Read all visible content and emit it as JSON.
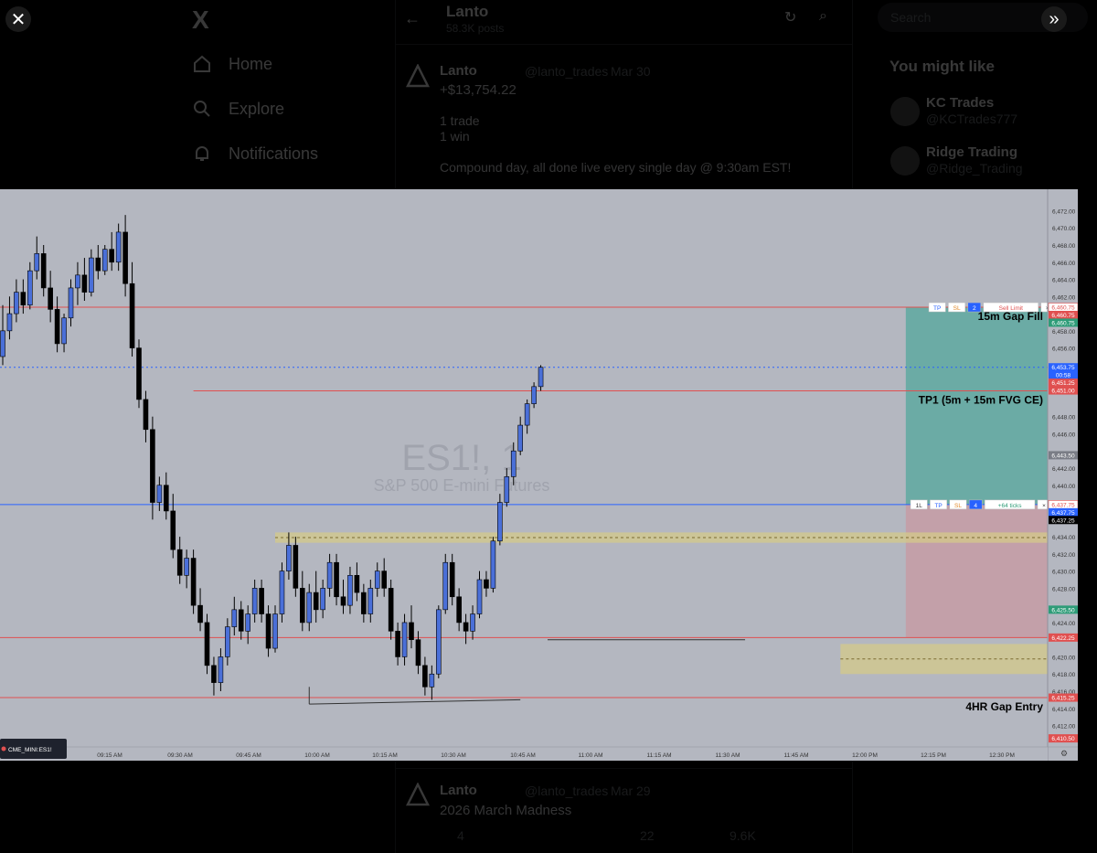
{
  "viewer": {
    "close_icon": "close-icon",
    "expand_icon": "expand-icon"
  },
  "sidebar": {
    "logo": "X",
    "items": [
      {
        "label": "Home",
        "icon": "home-icon"
      },
      {
        "label": "Explore",
        "icon": "search-icon"
      },
      {
        "label": "Notifications",
        "icon": "bell-icon"
      }
    ]
  },
  "header": {
    "author": "Lanto",
    "subtitle": "58.3K posts"
  },
  "post": {
    "name": "Lanto",
    "handle": "@lanto_trades",
    "date": "Mar 30",
    "amount": "+$13,754.22",
    "line1": "1 trade",
    "line2": "1 win",
    "body": "Compound day, all done live every single day @ 9:30am EST!"
  },
  "post2": {
    "name": "Lanto",
    "handle": "@lanto_trades",
    "date": "Mar 29",
    "body": "2026 March Madness",
    "stats": [
      "4",
      "",
      "22",
      "9.6K",
      "",
      ""
    ]
  },
  "right_panel": {
    "search_placeholder": "Search",
    "you_might_like": "You might like",
    "suggestions": [
      {
        "name": "KC Trades",
        "handle": "@KCTrades777"
      },
      {
        "name": "Ridge Trading",
        "handle": "@Ridge_Trading"
      }
    ]
  },
  "chart_data": {
    "type": "candlestick",
    "symbol": "ES1!, 1",
    "description": "S&P 500 E-mini Futures",
    "symbol_tag": "CME_MINI:ES1!",
    "colors": {
      "up": "#4a6fd8",
      "down": "#000000",
      "background": "#b4b7c0",
      "profit_zone": "#5ea9a0",
      "loss_zone": "#c59ca5",
      "fvg_zone": "#d4c98a",
      "level_line": "#e05050"
    },
    "y_axis": {
      "min": 6409.5,
      "max": 6474.5,
      "ticks": [
        "6,472.00",
        "6,470.00",
        "6,468.00",
        "6,466.00",
        "6,464.00",
        "6,462.00",
        "6,458.00",
        "6,456.00",
        "6,452.00",
        "6,448.00",
        "6,446.00",
        "6,442.00",
        "6,440.00",
        "6,434.00",
        "6,432.00",
        "6,430.00",
        "6,428.00",
        "6,424.00",
        "6,420.00",
        "6,418.00",
        "6,416.00",
        "6,414.00",
        "6,412.00"
      ]
    },
    "x_axis": {
      "ticks": [
        "09:15 AM",
        "09:30 AM",
        "09:45 AM",
        "10:00 AM",
        "10:15 AM",
        "10:30 AM",
        "10:45 AM",
        "11:00 AM",
        "11:15 AM",
        "11:30 AM",
        "11:45 AM",
        "12:00 PM",
        "12:15 PM",
        "12:30 PM"
      ]
    },
    "price_labels": [
      {
        "text": "6,460.75",
        "value": 6460.75,
        "color": "#ffffff",
        "textColor": "#e05050"
      },
      {
        "text": "6,460.75",
        "value": 6459.85,
        "color": "#e05050",
        "textColor": "#ffffff"
      },
      {
        "text": "6,460.75",
        "value": 6458.95,
        "color": "#2e9c78",
        "textColor": "#ffffff"
      },
      {
        "text": "6,453.75",
        "value": 6453.75,
        "color": "#2962ff",
        "textColor": "#ffffff"
      },
      {
        "text": "00:58",
        "value": 6452.85,
        "color": "#2962ff",
        "textColor": "#ffffff"
      },
      {
        "text": "6,451.25",
        "value": 6451.95,
        "color": "#e05050",
        "textColor": "#ffffff"
      },
      {
        "text": "6,451.00",
        "value": 6451.05,
        "color": "#e05050",
        "textColor": "#ffffff"
      },
      {
        "text": "6,443.50",
        "value": 6443.5,
        "color": "#7a7d86",
        "textColor": "#ffffff"
      },
      {
        "text": "6,437.75",
        "value": 6437.75,
        "color": "#ffffff",
        "textColor": "#e05050"
      },
      {
        "text": "6,437.75",
        "value": 6436.85,
        "color": "#2962ff",
        "textColor": "#ffffff"
      },
      {
        "text": "6,437.25",
        "value": 6435.95,
        "color": "#000000",
        "textColor": "#ffffff"
      },
      {
        "text": "6,425.50",
        "value": 6425.5,
        "color": "#2e9c78",
        "textColor": "#ffffff"
      },
      {
        "text": "6,422.25",
        "value": 6422.25,
        "color": "#e05050",
        "textColor": "#ffffff"
      },
      {
        "text": "6,415.25",
        "value": 6415.25,
        "color": "#e05050",
        "textColor": "#ffffff"
      },
      {
        "text": "6,410.50",
        "value": 6410.5,
        "color": "#e05050",
        "textColor": "#ffffff"
      }
    ],
    "annotations": [
      {
        "text": "15m Gap Fill",
        "value": 6460.75
      },
      {
        "text": "TP1 (5m + 15m FVG CE)",
        "value": 6451.0
      },
      {
        "text": "4HR Gap Entry",
        "value": 6415.25
      }
    ],
    "order_tags": [
      {
        "value": 6460.75,
        "items": [
          "TP",
          "SL",
          "2",
          "Sell Limit",
          "×"
        ]
      },
      {
        "value": 6437.75,
        "items": [
          "1L",
          "TP",
          "SL",
          "4",
          "+64 ticks",
          "×"
        ]
      }
    ],
    "levels": [
      {
        "value": 6460.75,
        "color": "#e05050",
        "style": "solid"
      },
      {
        "value": 6453.75,
        "color": "#2962ff",
        "style": "dotted"
      },
      {
        "value": 6451.0,
        "color": "#e05050",
        "style": "solid",
        "from_time": 28
      },
      {
        "value": 6437.75,
        "color": "#2962ff",
        "style": "solid"
      },
      {
        "value": 6422.25,
        "color": "#e05050",
        "style": "solid"
      },
      {
        "value": 6415.25,
        "color": "#e05050",
        "style": "solid"
      }
    ],
    "position": {
      "start": 133,
      "end": 191,
      "entry": 6437.75,
      "target": 6460.75,
      "stop": 6422.25
    },
    "zones": [
      {
        "start": 40,
        "end": 169,
        "top": 6434.5,
        "bottom": 6433.3,
        "mid": 6433.9
      },
      {
        "start": 123,
        "end": 191,
        "top": 6421.5,
        "bottom": 6418.0,
        "mid": 6419.75
      }
    ],
    "candles": [
      {
        "o": 6455.0,
        "h": 6461.0,
        "l": 6454.0,
        "c": 6458.0
      },
      {
        "o": 6458.0,
        "h": 6462.0,
        "l": 6457.0,
        "c": 6460.0
      },
      {
        "o": 6460.0,
        "h": 6464.0,
        "l": 6459.0,
        "c": 6462.5
      },
      {
        "o": 6462.5,
        "h": 6464.0,
        "l": 6460.0,
        "c": 6461.0
      },
      {
        "o": 6461.0,
        "h": 6466.0,
        "l": 6460.5,
        "c": 6465.0
      },
      {
        "o": 6465.0,
        "h": 6469.0,
        "l": 6464.0,
        "c": 6467.0
      },
      {
        "o": 6467.0,
        "h": 6468.0,
        "l": 6462.0,
        "c": 6463.0
      },
      {
        "o": 6463.0,
        "h": 6465.0,
        "l": 6459.0,
        "c": 6460.5
      },
      {
        "o": 6460.5,
        "h": 6462.0,
        "l": 6455.5,
        "c": 6456.5
      },
      {
        "o": 6456.5,
        "h": 6460.0,
        "l": 6455.5,
        "c": 6459.5
      },
      {
        "o": 6459.5,
        "h": 6464.0,
        "l": 6458.5,
        "c": 6463.0
      },
      {
        "o": 6463.0,
        "h": 6466.0,
        "l": 6461.0,
        "c": 6464.5
      },
      {
        "o": 6464.5,
        "h": 6466.5,
        "l": 6461.5,
        "c": 6462.5
      },
      {
        "o": 6462.5,
        "h": 6467.5,
        "l": 6462.0,
        "c": 6466.5
      },
      {
        "o": 6466.5,
        "h": 6468.0,
        "l": 6464.0,
        "c": 6465.0
      },
      {
        "o": 6465.0,
        "h": 6468.0,
        "l": 6464.5,
        "c": 6467.5
      },
      {
        "o": 6467.5,
        "h": 6469.5,
        "l": 6465.0,
        "c": 6466.0
      },
      {
        "o": 6466.0,
        "h": 6470.5,
        "l": 6465.0,
        "c": 6469.5
      },
      {
        "o": 6469.5,
        "h": 6471.5,
        "l": 6462.0,
        "c": 6463.5
      },
      {
        "o": 6463.5,
        "h": 6466.0,
        "l": 6455.0,
        "c": 6456.0
      },
      {
        "o": 6456.0,
        "h": 6457.0,
        "l": 6449.0,
        "c": 6450.0
      },
      {
        "o": 6450.0,
        "h": 6451.0,
        "l": 6445.0,
        "c": 6446.5
      },
      {
        "o": 6446.5,
        "h": 6448.0,
        "l": 6436.0,
        "c": 6438.0
      },
      {
        "o": 6438.0,
        "h": 6441.0,
        "l": 6437.0,
        "c": 6440.0
      },
      {
        "o": 6440.0,
        "h": 6441.5,
        "l": 6436.0,
        "c": 6437.0
      },
      {
        "o": 6437.0,
        "h": 6439.0,
        "l": 6431.5,
        "c": 6432.5
      },
      {
        "o": 6432.5,
        "h": 6434.0,
        "l": 6428.5,
        "c": 6429.5
      },
      {
        "o": 6429.5,
        "h": 6432.5,
        "l": 6428.0,
        "c": 6431.5
      },
      {
        "o": 6431.5,
        "h": 6432.5,
        "l": 6425.0,
        "c": 6426.0
      },
      {
        "o": 6426.0,
        "h": 6428.0,
        "l": 6423.0,
        "c": 6424.0
      },
      {
        "o": 6424.0,
        "h": 6425.0,
        "l": 6418.0,
        "c": 6419.0
      },
      {
        "o": 6419.0,
        "h": 6420.0,
        "l": 6415.5,
        "c": 6417.0
      },
      {
        "o": 6417.0,
        "h": 6421.0,
        "l": 6416.0,
        "c": 6420.0
      },
      {
        "o": 6420.0,
        "h": 6424.5,
        "l": 6419.0,
        "c": 6423.5
      },
      {
        "o": 6423.5,
        "h": 6427.0,
        "l": 6422.5,
        "c": 6425.5
      },
      {
        "o": 6425.5,
        "h": 6426.5,
        "l": 6422.0,
        "c": 6423.0
      },
      {
        "o": 6423.0,
        "h": 6426.0,
        "l": 6421.5,
        "c": 6425.0
      },
      {
        "o": 6425.0,
        "h": 6429.0,
        "l": 6424.0,
        "c": 6428.0
      },
      {
        "o": 6428.0,
        "h": 6429.0,
        "l": 6424.0,
        "c": 6425.0
      },
      {
        "o": 6425.0,
        "h": 6426.0,
        "l": 6420.0,
        "c": 6421.0
      },
      {
        "o": 6421.0,
        "h": 6426.0,
        "l": 6420.5,
        "c": 6425.0
      },
      {
        "o": 6425.0,
        "h": 6431.0,
        "l": 6424.0,
        "c": 6430.0
      },
      {
        "o": 6430.0,
        "h": 6434.5,
        "l": 6429.0,
        "c": 6433.0
      },
      {
        "o": 6433.0,
        "h": 6434.0,
        "l": 6427.0,
        "c": 6428.0
      },
      {
        "o": 6428.0,
        "h": 6430.0,
        "l": 6423.0,
        "c": 6424.0
      },
      {
        "o": 6424.0,
        "h": 6428.5,
        "l": 6423.0,
        "c": 6427.5
      },
      {
        "o": 6427.5,
        "h": 6430.0,
        "l": 6424.0,
        "c": 6425.5
      },
      {
        "o": 6425.5,
        "h": 6429.0,
        "l": 6424.5,
        "c": 6428.0
      },
      {
        "o": 6428.0,
        "h": 6432.0,
        "l": 6427.0,
        "c": 6431.0
      },
      {
        "o": 6431.0,
        "h": 6432.0,
        "l": 6426.0,
        "c": 6427.0
      },
      {
        "o": 6427.0,
        "h": 6429.0,
        "l": 6425.0,
        "c": 6426.0
      },
      {
        "o": 6426.0,
        "h": 6430.5,
        "l": 6425.0,
        "c": 6429.5
      },
      {
        "o": 6429.5,
        "h": 6431.0,
        "l": 6426.5,
        "c": 6427.5
      },
      {
        "o": 6427.5,
        "h": 6428.5,
        "l": 6424.0,
        "c": 6425.0
      },
      {
        "o": 6425.0,
        "h": 6429.0,
        "l": 6424.0,
        "c": 6428.0
      },
      {
        "o": 6428.0,
        "h": 6431.0,
        "l": 6427.0,
        "c": 6430.0
      },
      {
        "o": 6430.0,
        "h": 6431.5,
        "l": 6427.0,
        "c": 6428.0
      },
      {
        "o": 6428.0,
        "h": 6429.0,
        "l": 6422.0,
        "c": 6423.0
      },
      {
        "o": 6423.0,
        "h": 6424.0,
        "l": 6419.0,
        "c": 6420.0
      },
      {
        "o": 6420.0,
        "h": 6425.0,
        "l": 6419.0,
        "c": 6424.0
      },
      {
        "o": 6424.0,
        "h": 6426.0,
        "l": 6421.0,
        "c": 6422.0
      },
      {
        "o": 6422.0,
        "h": 6423.0,
        "l": 6418.0,
        "c": 6419.0
      },
      {
        "o": 6419.0,
        "h": 6420.0,
        "l": 6415.5,
        "c": 6416.5
      },
      {
        "o": 6416.5,
        "h": 6419.0,
        "l": 6415.0,
        "c": 6418.0
      },
      {
        "o": 6418.0,
        "h": 6426.0,
        "l": 6417.5,
        "c": 6425.5
      },
      {
        "o": 6425.5,
        "h": 6432.0,
        "l": 6425.0,
        "c": 6431.0
      },
      {
        "o": 6431.0,
        "h": 6432.0,
        "l": 6426.0,
        "c": 6427.0
      },
      {
        "o": 6427.0,
        "h": 6428.0,
        "l": 6423.0,
        "c": 6424.0
      },
      {
        "o": 6424.0,
        "h": 6425.0,
        "l": 6421.5,
        "c": 6423.0
      },
      {
        "o": 6423.0,
        "h": 6426.0,
        "l": 6422.0,
        "c": 6425.0
      },
      {
        "o": 6425.0,
        "h": 6430.0,
        "l": 6424.5,
        "c": 6429.0
      },
      {
        "o": 6429.0,
        "h": 6430.0,
        "l": 6427.0,
        "c": 6428.0
      },
      {
        "o": 6428.0,
        "h": 6434.0,
        "l": 6427.5,
        "c": 6433.5
      },
      {
        "o": 6433.5,
        "h": 6439.0,
        "l": 6433.0,
        "c": 6438.0
      },
      {
        "o": 6438.0,
        "h": 6442.0,
        "l": 6437.5,
        "c": 6441.0
      },
      {
        "o": 6441.0,
        "h": 6445.0,
        "l": 6440.0,
        "c": 6444.0
      },
      {
        "o": 6444.0,
        "h": 6448.0,
        "l": 6443.5,
        "c": 6447.0
      },
      {
        "o": 6447.0,
        "h": 6450.0,
        "l": 6446.0,
        "c": 6449.5
      },
      {
        "o": 6449.5,
        "h": 6452.0,
        "l": 6449.0,
        "c": 6451.5
      },
      {
        "o": 6451.5,
        "h": 6454.0,
        "l": 6451.0,
        "c": 6453.75
      }
    ]
  }
}
